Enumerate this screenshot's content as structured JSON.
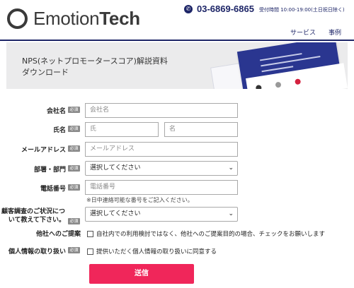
{
  "header": {
    "logo_prefix": "Emotion",
    "logo_bold": "Tech",
    "phone_icon": "phone-icon",
    "phone": "03-6869-6865",
    "hours": "受付時間 10:00-19:00(土日祝日除く)",
    "nav": [
      "サービス",
      "事例"
    ],
    "accent_color": "#1d2567"
  },
  "banner": {
    "title_line1": "NPS(ネットプロモータースコア)解説資料",
    "title_line2": "ダウンロード"
  },
  "form": {
    "required_badge": "必須",
    "company": {
      "label": "会社名",
      "placeholder": "会社名"
    },
    "name": {
      "label": "氏名",
      "last_placeholder": "氏",
      "first_placeholder": "名"
    },
    "email": {
      "label": "メールアドレス",
      "placeholder": "メールアドレス"
    },
    "department": {
      "label": "部署・部門",
      "value": "選択してください"
    },
    "phone": {
      "label": "電話番号",
      "placeholder": "電話番号",
      "note": "※日中連絡可能な番号をご記入ください。"
    },
    "survey_status": {
      "label_line1": "顧客調査のご状況につ",
      "label_line2": "いて教えて下さい。",
      "value": "選択してください"
    },
    "other_proposal": {
      "label": "他社へのご提案",
      "text": "自社内での利用検討ではなく、他社へのご提案目的の場合、チェックをお願いします"
    },
    "privacy": {
      "label": "個人情報の取り扱い",
      "text": "提供いただく個人情報の取り扱いに同意する"
    },
    "submit_label": "送信",
    "submit_color": "#f0265a"
  }
}
